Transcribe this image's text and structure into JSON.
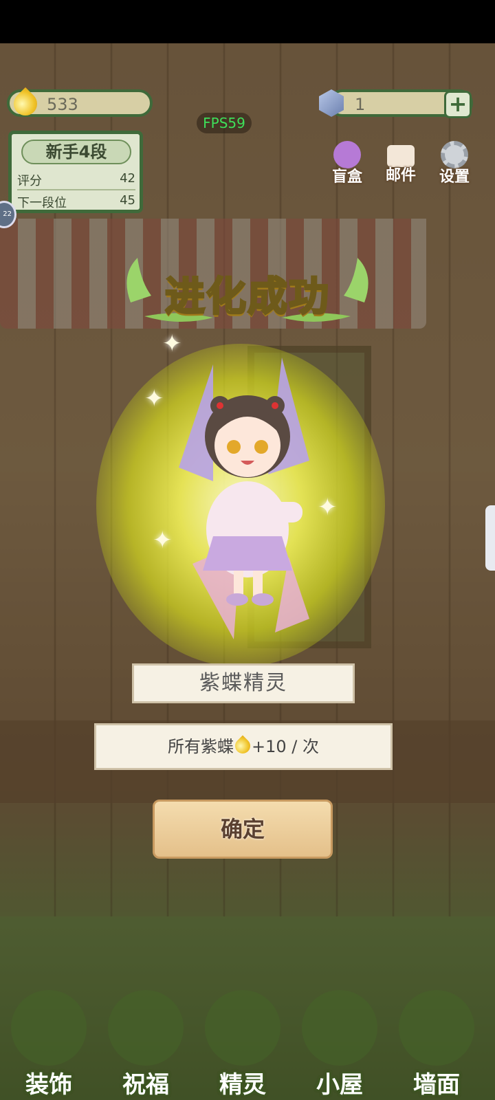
{
  "header": {
    "coins": "533",
    "gems": "1",
    "plus_label": "+",
    "fps": "FPS59"
  },
  "rank": {
    "title": "新手4段",
    "score_label": "评分",
    "score_value": "42",
    "next_label": "下一段位",
    "next_value": "45"
  },
  "top_icons": [
    {
      "label": "盲盒",
      "icon": "mystery-box-icon",
      "color": "#b67ad6"
    },
    {
      "label": "邮件",
      "icon": "mail-icon",
      "color": "#f3e7d8"
    },
    {
      "label": "设置",
      "icon": "gear-icon",
      "color": "#cfd3d8"
    }
  ],
  "popup": {
    "title": "进化成功",
    "fairy_name": "紫蝶精灵",
    "bonus_prefix": "所有紫蝶",
    "bonus_suffix": "+10 / 次",
    "confirm_label": "确定"
  },
  "bottom_nav": [
    {
      "label": "装饰",
      "icon": "plant-icon"
    },
    {
      "label": "祝福",
      "icon": "butterfly-icon"
    },
    {
      "label": "精灵",
      "icon": "fairy-icon"
    },
    {
      "label": "小屋",
      "icon": "house-icon"
    },
    {
      "label": "墙面",
      "icon": "bell-icon"
    }
  ],
  "colors": {
    "accent_green": "#3f6a3a",
    "glow_yellow": "#f0f05a",
    "title_yellow": "#ffe35a"
  }
}
